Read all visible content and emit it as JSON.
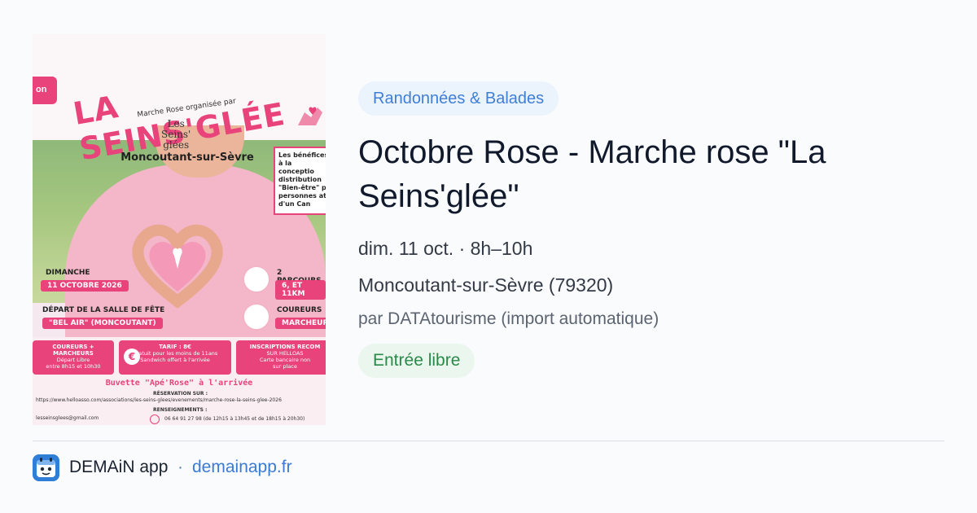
{
  "poster": {
    "badge_text": "on",
    "title": "LA SEINS'GLÉE",
    "subtitle": "Marche Rose organisée par",
    "org_logo": [
      "Les",
      "Seins'",
      "glées"
    ],
    "town": "Moncoutant-sur-Sèvre",
    "benefits": [
      "Les bénéfices",
      "à la conceptio",
      "distribution",
      "\"Bien-être\" p",
      "personnes at",
      "d'un Can"
    ],
    "day_label": "DIMANCHE",
    "date_pill": "11 OCTOBRE 2026",
    "depart_label": "DÉPART DE LA SALLE DE FÊTE",
    "place_pill": "\"BEL AIR\" (MONCOUTANT)",
    "routes_label": "2 PARCOURS",
    "routes_pill": "6, ET 11KM",
    "runners_label": "COUREURS",
    "walkers_pill": "MARCHEUR",
    "box1_title": "COUREURS + MARCHEURS",
    "box1_lines": [
      "Départ Libre",
      "entre 8h15 et 10h30"
    ],
    "box2_title": "TARIF : 8€",
    "box2_lines": [
      "Gratuit pour les moins de 11ans",
      "Sandwich offert à l'arrivée"
    ],
    "euro_symbol": "€",
    "box3_title": "INSCRIPTIONS RECOM",
    "box3_lines": [
      "SUR HELLOAS",
      "Carte bancaire non",
      "sur place"
    ],
    "buvette": "Buvette \"Apé'Rose\" à l'arrivée",
    "reservation_label": "RÉSERVATION SUR :",
    "reservation_url": "https://www.helloasso.com/associations/les-seins-glees/evenements/marche-rose-la-seins-glee-2026",
    "renseignements_label": "RENSEIGNEMENTS :",
    "email": "lesseinsglees@gmail.com",
    "phone": "06 64 91 27 98 (de 12h15 à 13h45 et de 18h15 à 20h30)"
  },
  "event": {
    "category": "Randonnées & Balades",
    "title": "Octobre Rose - Marche rose \"La Seins'glée\"",
    "datetime": "dim. 11 oct. · 8h–10h",
    "location": "Moncoutant-sur-Sèvre (79320)",
    "organizer": "par DATAtourisme (import automatique)",
    "price": "Entrée libre"
  },
  "footer": {
    "app_name": "DEMAiN app",
    "separator": "·",
    "domain": "demainapp.fr"
  },
  "colors": {
    "accent_pink": "#e8437a",
    "tag_blue": "#3f7fd6",
    "badge_green": "#2a8a49",
    "app_blue": "#2f7fd9"
  },
  "icons": [
    "route-pin-icon",
    "running-shoe-icon",
    "euro-icon",
    "form-icon",
    "phone-icon",
    "hands-heart-icon",
    "app-logo-icon"
  ]
}
